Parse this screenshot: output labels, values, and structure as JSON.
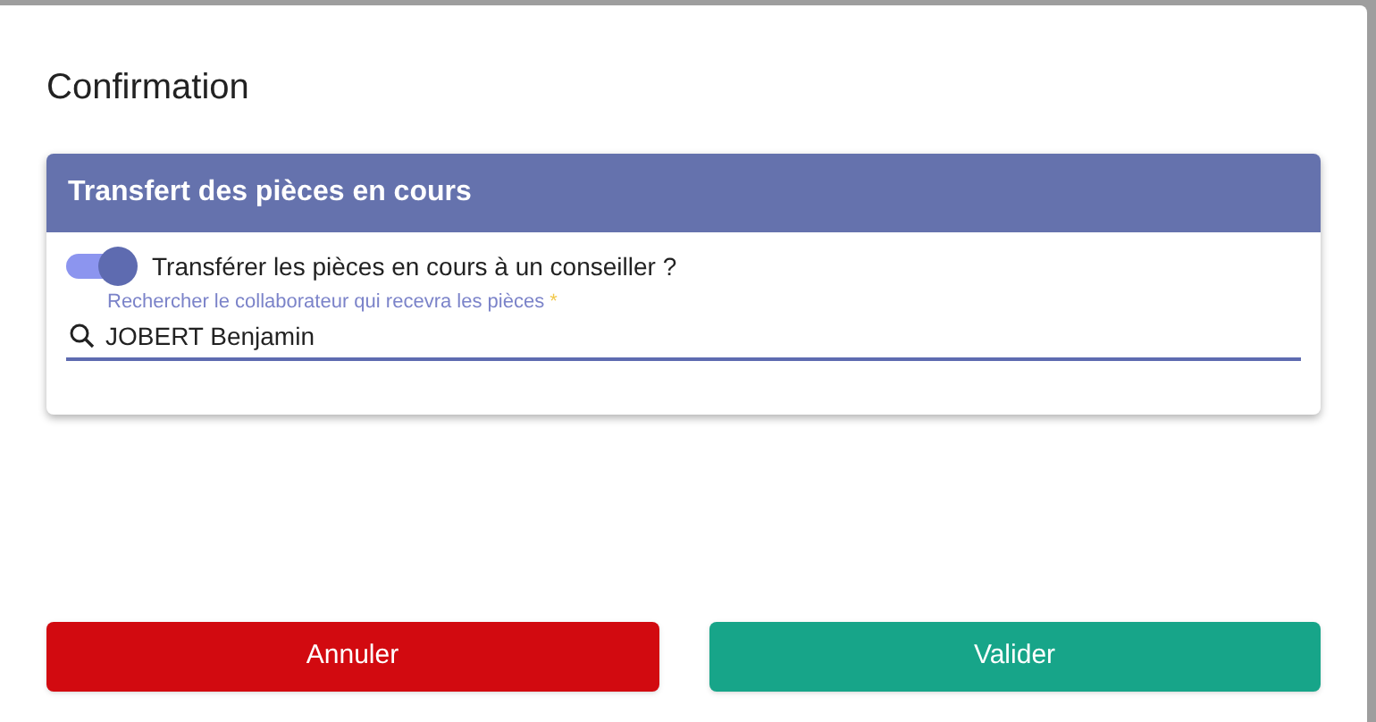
{
  "dialog": {
    "title": "Confirmation"
  },
  "card": {
    "title": "Transfert des pièces en cours",
    "toggle": {
      "label": "Transférer les pièces en cours à un conseiller ?",
      "on": true
    },
    "search": {
      "label": "Rechercher le collaborateur qui recevra les pièces",
      "required_mark": "*",
      "value": "JOBERT Benjamin"
    }
  },
  "buttons": [
    {
      "label": "Annuler",
      "kind": "cancel"
    },
    {
      "label": "Valider",
      "kind": "confirm"
    }
  ]
}
